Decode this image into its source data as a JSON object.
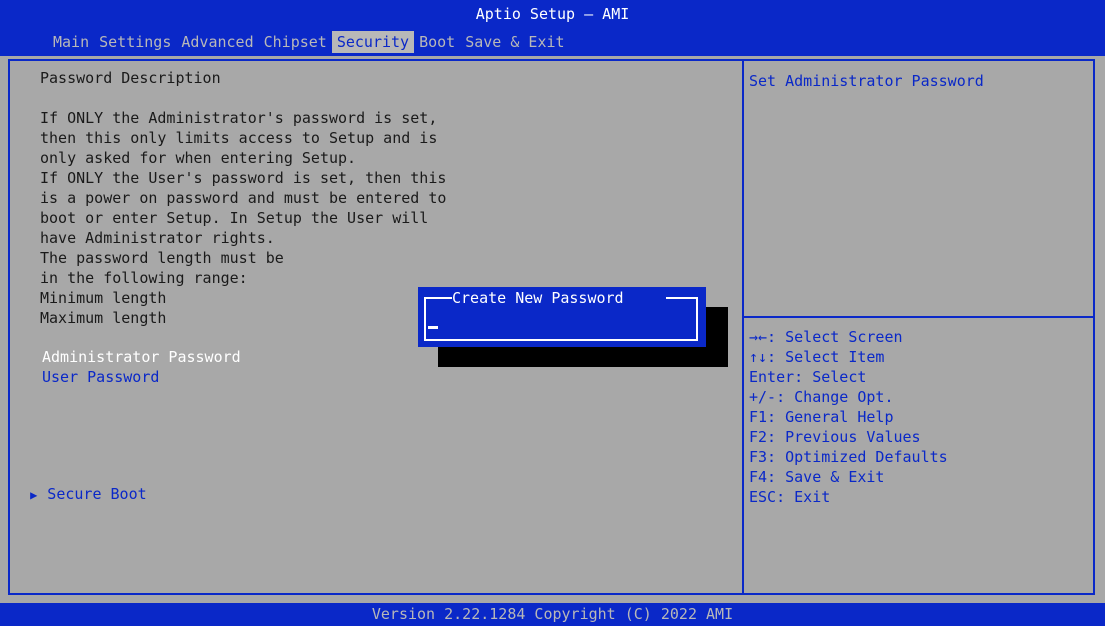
{
  "header": {
    "title": "Aptio Setup – AMI",
    "tabs": [
      {
        "label": "Main"
      },
      {
        "label": "Settings"
      },
      {
        "label": "Advanced"
      },
      {
        "label": "Chipset"
      },
      {
        "label": "Security",
        "active": true
      },
      {
        "label": "Boot"
      },
      {
        "label": "Save & Exit"
      }
    ]
  },
  "main": {
    "description_heading": "Password Description",
    "description_lines": [
      "If ONLY the Administrator's password is set,",
      "then this only limits access to Setup and is",
      "only asked for when entering Setup.",
      "If ONLY the User's password is set, then this",
      "is a power on password and must be entered to",
      "boot or enter Setup. In Setup the User will",
      "have Administrator rights.",
      "The password length must be",
      "in the following range:",
      "Minimum length",
      "Maximum length"
    ],
    "items": {
      "administrator_password": "Administrator Password",
      "user_password": "User Password",
      "secure_boot": "Secure Boot"
    }
  },
  "help": {
    "title": "Set Administrator Password",
    "keys": [
      "→←: Select Screen",
      "↑↓: Select Item",
      "Enter: Select",
      "+/-: Change Opt.",
      "F1: General Help",
      "F2: Previous Values",
      "F3: Optimized Defaults",
      "F4: Save & Exit",
      "ESC: Exit"
    ]
  },
  "dialog": {
    "title": "Create New Password",
    "value": ""
  },
  "footer": {
    "version": "Version 2.22.1284 Copyright (C) 2022 AMI"
  },
  "colors": {
    "bios_blue": "#0a28c8",
    "panel_gray": "#a8a8a8",
    "highlight_white": "#ffffff"
  }
}
